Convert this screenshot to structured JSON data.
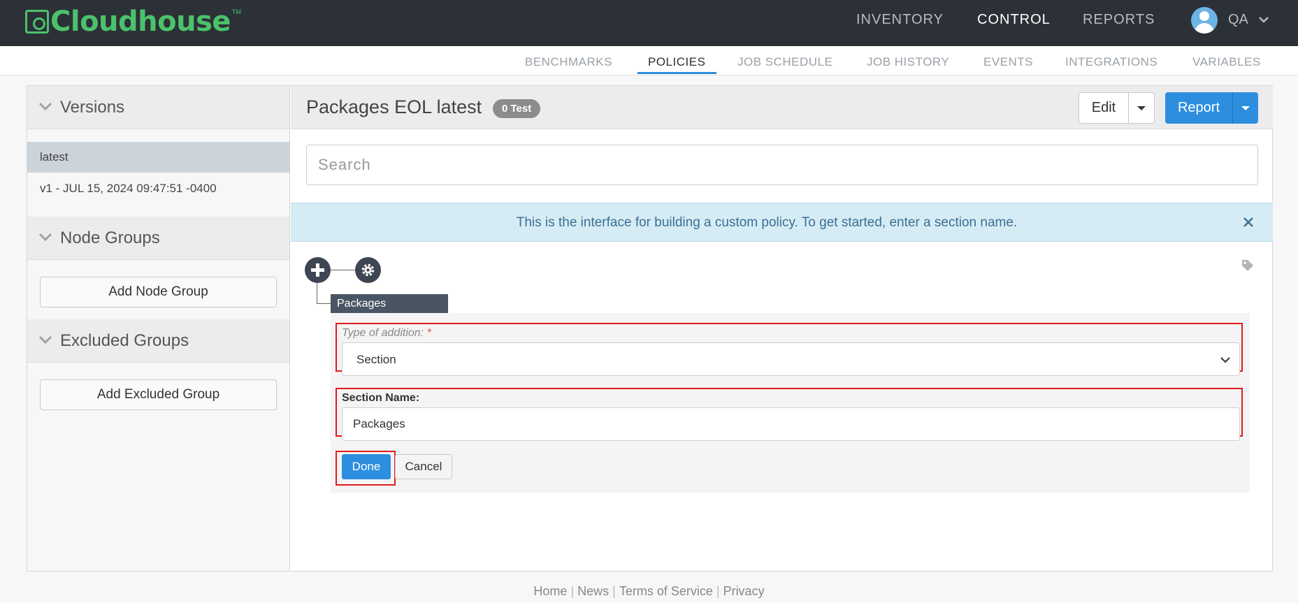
{
  "brand": {
    "name": "Cloudhouse",
    "tm": "TM",
    "color": "#4cc26a"
  },
  "topnav": {
    "items": [
      {
        "label": "INVENTORY",
        "active": false
      },
      {
        "label": "CONTROL",
        "active": true
      },
      {
        "label": "REPORTS",
        "active": false
      }
    ],
    "user": {
      "name": "QA",
      "icon": "user-avatar-icon"
    }
  },
  "subnav": {
    "items": [
      {
        "label": "BENCHMARKS",
        "active": false
      },
      {
        "label": "POLICIES",
        "active": true
      },
      {
        "label": "JOB SCHEDULE",
        "active": false
      },
      {
        "label": "JOB HISTORY",
        "active": false
      },
      {
        "label": "EVENTS",
        "active": false
      },
      {
        "label": "INTEGRATIONS",
        "active": false
      },
      {
        "label": "VARIABLES",
        "active": false
      }
    ]
  },
  "sidebar": {
    "versions": {
      "title": "Versions",
      "items": [
        {
          "label": "latest",
          "selected": true
        },
        {
          "label": "v1 - JUL 15, 2024 09:47:51 -0400",
          "selected": false
        }
      ]
    },
    "node_groups": {
      "title": "Node Groups",
      "button": "Add Node Group"
    },
    "excluded_groups": {
      "title": "Excluded Groups",
      "button": "Add Excluded Group"
    }
  },
  "policy": {
    "title": "Packages EOL latest",
    "badge": "0 Test",
    "edit_label": "Edit",
    "report_label": "Report"
  },
  "search": {
    "placeholder": "Search",
    "value": ""
  },
  "alert": {
    "text": "This is the interface for building a custom policy. To get started, enter a section name."
  },
  "tree": {
    "node_label": "Packages"
  },
  "form": {
    "type_label": "Type of addition:",
    "required_mark": "*",
    "type_value": "Section",
    "section_label": "Section Name:",
    "section_value": "Packages",
    "done_label": "Done",
    "cancel_label": "Cancel"
  },
  "footer": {
    "links": [
      "Home",
      "News",
      "Terms of Service",
      "Privacy"
    ]
  },
  "colors": {
    "accent": "#2d8ee0",
    "topbar": "#2c3138",
    "highlight": "#e01b1b"
  }
}
